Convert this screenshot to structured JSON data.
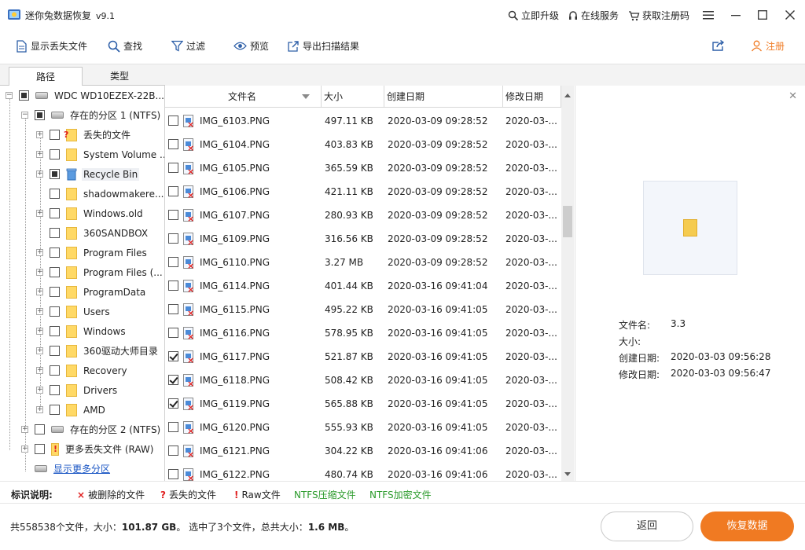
{
  "app": {
    "title": "迷你兔数据恢复",
    "version": "v9.1"
  },
  "titlebar": {
    "upgrade": "立即升级",
    "online_service": "在线服务",
    "get_code": "获取注册码"
  },
  "toolbar": {
    "show_lost": "显示丢失文件",
    "find": "查找",
    "filter": "过滤",
    "preview": "预览",
    "export": "导出扫描结果",
    "register": "注册"
  },
  "tabs": [
    "路径",
    "类型"
  ],
  "tree": {
    "disk": "WDC WD10EZEX-22B...",
    "partition1": "存在的分区 1 (NTFS)",
    "children": [
      {
        "label": "丢失的文件",
        "icon": "lost-folder-icon"
      },
      {
        "label": "System Volume ...",
        "icon": "folder-icon"
      },
      {
        "label": "Recycle Bin",
        "icon": "recycle-bin-icon"
      },
      {
        "label": "shadowmakere...",
        "icon": "folder-icon"
      },
      {
        "label": "Windows.old",
        "icon": "folder-icon"
      },
      {
        "label": "360SANDBOX",
        "icon": "folder-icon"
      },
      {
        "label": "Program Files",
        "icon": "folder-icon"
      },
      {
        "label": "Program Files (...",
        "icon": "folder-icon"
      },
      {
        "label": "ProgramData",
        "icon": "folder-icon"
      },
      {
        "label": "Users",
        "icon": "folder-icon"
      },
      {
        "label": "Windows",
        "icon": "folder-icon"
      },
      {
        "label": "360驱动大师目录",
        "icon": "folder-icon"
      },
      {
        "label": "Recovery",
        "icon": "folder-icon"
      },
      {
        "label": "Drivers",
        "icon": "folder-icon"
      },
      {
        "label": "AMD",
        "icon": "folder-icon"
      }
    ],
    "partition2": "存在的分区 2 (NTFS)",
    "more_lost": "更多丢失文件 (RAW)",
    "show_more": "显示更多分区"
  },
  "file_table": {
    "columns": [
      "文件名",
      "大小",
      "创建日期",
      "修改日期"
    ],
    "rows": [
      {
        "name": "IMG_6103.PNG",
        "size": "497.11 KB",
        "created": "2020-03-09 09:28:52",
        "modified": "2020-03-...",
        "checked": false
      },
      {
        "name": "IMG_6104.PNG",
        "size": "403.83 KB",
        "created": "2020-03-09 09:28:52",
        "modified": "2020-03-...",
        "checked": false
      },
      {
        "name": "IMG_6105.PNG",
        "size": "365.59 KB",
        "created": "2020-03-09 09:28:52",
        "modified": "2020-03-...",
        "checked": false
      },
      {
        "name": "IMG_6106.PNG",
        "size": "421.11 KB",
        "created": "2020-03-09 09:28:52",
        "modified": "2020-03-...",
        "checked": false
      },
      {
        "name": "IMG_6107.PNG",
        "size": "280.93 KB",
        "created": "2020-03-09 09:28:52",
        "modified": "2020-03-...",
        "checked": false
      },
      {
        "name": "IMG_6109.PNG",
        "size": "316.56 KB",
        "created": "2020-03-09 09:28:52",
        "modified": "2020-03-...",
        "checked": false
      },
      {
        "name": "IMG_6110.PNG",
        "size": "3.27 MB",
        "created": "2020-03-09 09:28:52",
        "modified": "2020-03-...",
        "checked": false
      },
      {
        "name": "IMG_6114.PNG",
        "size": "401.44 KB",
        "created": "2020-03-16 09:41:04",
        "modified": "2020-03-...",
        "checked": false
      },
      {
        "name": "IMG_6115.PNG",
        "size": "495.22 KB",
        "created": "2020-03-16 09:41:05",
        "modified": "2020-03-...",
        "checked": false
      },
      {
        "name": "IMG_6116.PNG",
        "size": "578.95 KB",
        "created": "2020-03-16 09:41:05",
        "modified": "2020-03-...",
        "checked": false
      },
      {
        "name": "IMG_6117.PNG",
        "size": "521.87 KB",
        "created": "2020-03-16 09:41:05",
        "modified": "2020-03-...",
        "checked": true
      },
      {
        "name": "IMG_6118.PNG",
        "size": "508.42 KB",
        "created": "2020-03-16 09:41:05",
        "modified": "2020-03-...",
        "checked": true
      },
      {
        "name": "IMG_6119.PNG",
        "size": "565.88 KB",
        "created": "2020-03-16 09:41:05",
        "modified": "2020-03-...",
        "checked": true
      },
      {
        "name": "IMG_6120.PNG",
        "size": "555.93 KB",
        "created": "2020-03-16 09:41:05",
        "modified": "2020-03-...",
        "checked": false
      },
      {
        "name": "IMG_6121.PNG",
        "size": "304.22 KB",
        "created": "2020-03-16 09:41:06",
        "modified": "2020-03-...",
        "checked": false
      },
      {
        "name": "IMG_6122.PNG",
        "size": "480.74 KB",
        "created": "2020-03-16 09:41:06",
        "modified": "2020-03-...",
        "checked": false
      }
    ]
  },
  "preview": {
    "name_label": "文件名:",
    "name_value": "3.3",
    "size_label": "大小:",
    "size_value": "",
    "created_label": "创建日期:",
    "created_value": "2020-03-03 09:56:28",
    "modified_label": "修改日期:",
    "modified_value": "2020-03-03 09:56:47"
  },
  "legend": {
    "title": "标识说明:",
    "deleted": "被删除的文件",
    "lost": "丢失的文件",
    "raw": "Raw文件",
    "ntfs_compressed": "NTFS压缩文件",
    "ntfs_encrypted": "NTFS加密文件"
  },
  "status": {
    "prefix": "共",
    "total_files": "558538",
    "files_suffix": "个文件，大小：",
    "total_size": "101.87 GB",
    "selected_prefix": "。 选中了",
    "selected_count": "3",
    "selected_mid": "个文件，总共大小：",
    "selected_size": "1.6 MB",
    "end": "。"
  },
  "buttons": {
    "back": "返回",
    "recover": "恢复数据"
  },
  "colors": {
    "accent": "#f07a22",
    "deleted_mark": "#e02020",
    "ntfs_green": "#2a9a2a",
    "link_blue": "#1a56c4"
  }
}
